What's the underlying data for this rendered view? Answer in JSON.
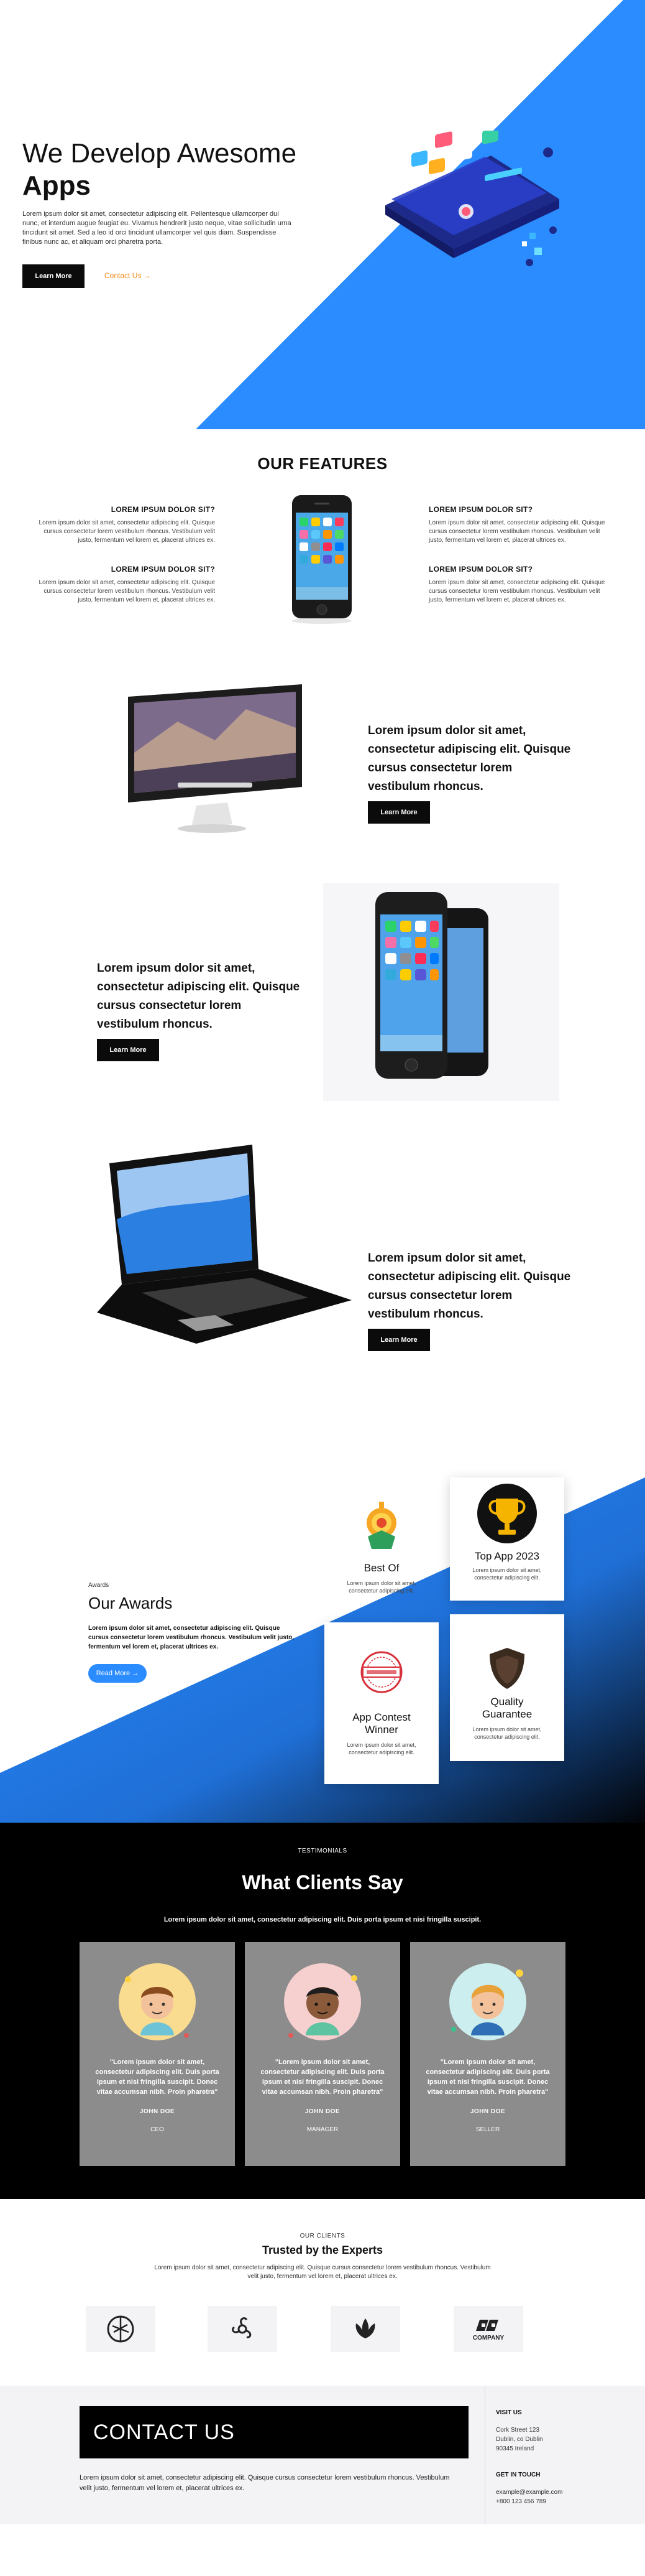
{
  "hero": {
    "title_line1": "We Develop Awesome",
    "title_line2": "Apps",
    "text": "Lorem ipsum dolor sit amet, consectetur adipiscing elit. Pellentesque ullamcorper dui nunc, et interdum augue feugiat eu. Vivamus hendrerit justo neque, vitae sollicitudin urna tincidunt sit amet. Sed a leo id orci tincidunt ullamcorper vel quis diam. Suspendisse finibus nunc ac, et aliquam orci pharetra porta.",
    "primary_button": "Learn More",
    "secondary_link": "Contact Us →",
    "accent_color": "#2b8cff"
  },
  "features": {
    "title": "OUR FEATURES",
    "items": [
      {
        "heading": "LOREM IPSUM DOLOR SIT?",
        "text": "Lorem ipsum dolor sit amet, consectetur adipiscing elit. Quisque cursus consectetur lorem vestibulum rhoncus. Vestibulum velit justo, fermentum vel lorem et, placerat ultrices ex."
      },
      {
        "heading": "LOREM IPSUM DOLOR SIT?",
        "text": "Lorem ipsum dolor sit amet, consectetur adipiscing elit. Quisque cursus consectetur lorem vestibulum rhoncus. Vestibulum velit justo, fermentum vel lorem et, placerat ultrices ex."
      },
      {
        "heading": "LOREM IPSUM DOLOR SIT?",
        "text": "Lorem ipsum dolor sit amet, consectetur adipiscing elit. Quisque cursus consectetur lorem vestibulum rhoncus. Vestibulum velit justo, fermentum vel lorem et, placerat ultrices ex."
      },
      {
        "heading": "LOREM IPSUM DOLOR SIT?",
        "text": "Lorem ipsum dolor sit amet, consectetur adipiscing elit. Quisque cursus consectetur lorem vestibulum rhoncus. Vestibulum velit justo, fermentum vel lorem et, placerat ultrices ex."
      }
    ]
  },
  "rows": [
    {
      "text": "Lorem ipsum dolor sit amet, consectetur adipiscing elit. Quisque cursus consectetur lorem vestibulum rhoncus.",
      "button": "Learn More",
      "device": "desktop-monitor"
    },
    {
      "text": "Lorem ipsum dolor sit amet, consectetur adipiscing elit. Quisque cursus consectetur lorem vestibulum rhoncus.",
      "button": "Learn More",
      "device": "two-phones"
    },
    {
      "text": "Lorem ipsum dolor sit amet, consectetur adipiscing elit. Quisque cursus consectetur lorem vestibulum rhoncus.",
      "button": "Learn More",
      "device": "laptop"
    }
  ],
  "awards": {
    "eyebrow": "Awards",
    "title": "Our Awards",
    "text": "Lorem ipsum dolor sit amet, consectetur adipiscing elit. Quisque cursus consectetur lorem vestibulum rhoncus. Vestibulum velit justo, fermentum vel lorem et, placerat ultrices ex.",
    "button": "Read More →",
    "cards": [
      {
        "title": "Best Of",
        "text": "Lorem ipsum dolor sit amet, consectetur adipiscing elit.",
        "icon": "medal-icon"
      },
      {
        "title": "Top App 2023",
        "text": "Lorem ipsum dolor sit amet, consectetur adipiscing elit.",
        "icon": "trophy-icon"
      },
      {
        "title": "App Contest Winner",
        "text": "Lorem ipsum dolor sit amet, consectetur adipiscing elit.",
        "icon": "winner-stamp-icon"
      },
      {
        "title": "Quality Guarantee",
        "text": "Lorem ipsum dolor sit amet, consectetur adipiscing elit.",
        "icon": "shield-icon"
      }
    ]
  },
  "testimonials": {
    "eyebrow": "TESTIMONIALS",
    "title": "What Clients Say",
    "subtitle": "Lorem ipsum dolor sit amet, consectetur adipiscing elit. Duis porta ipsum et nisi fringilla suscipit.",
    "items": [
      {
        "quote": "\"Lorem ipsum dolor sit amet, consectetur adipiscing elit. Duis porta ipsum et nisi fringilla suscipit. Donec vitae accumsan nibh. Proin pharetra\"",
        "name": "JOHN DOE",
        "role": "CEO",
        "avatar_bg": "#f9dc8f"
      },
      {
        "quote": "\"Lorem ipsum dolor sit amet, consectetur adipiscing elit. Duis porta ipsum et nisi fringilla suscipit. Donec vitae accumsan nibh. Proin pharetra\"",
        "name": "JOHN DOE",
        "role": "MANAGER",
        "avatar_bg": "#f6cfcf"
      },
      {
        "quote": "\"Lorem ipsum dolor sit amet, consectetur adipiscing elit. Duis porta ipsum et nisi fringilla suscipit. Donec vitae accumsan nibh. Proin pharetra\"",
        "name": "JOHN DOE",
        "role": "SELLER",
        "avatar_bg": "#cdeeee"
      }
    ]
  },
  "clients": {
    "eyebrow": "OUR CLIENTS",
    "title": "Trusted by the Experts",
    "text": "Lorem ipsum dolor sit amet, consectetur adipiscing elit. Quisque cursus consectetur lorem vestibulum rhoncus. Vestibulum velit justo, fermentum vel lorem et, placerat ultrices ex.",
    "logos": [
      "circle-logo",
      "triskelion-logo",
      "lotus-logo",
      "company-logo"
    ],
    "company_label": "COMPANY"
  },
  "contact": {
    "title": "CONTACT US",
    "text": "Lorem ipsum dolor sit amet, consectetur adipiscing elit. Quisque cursus consectetur lorem vestibulum rhoncus. Vestibulum velit justo, fermentum vel lorem et, placerat ultrices ex.",
    "visit_heading": "VISIT US",
    "address1": "Cork Street 123",
    "address2": "Dublin, co Dublin",
    "address3": "90345 Ireland",
    "touch_heading": "GET IN TOUCH",
    "email": "example@example.com",
    "phone": "+800 123 456 789"
  }
}
